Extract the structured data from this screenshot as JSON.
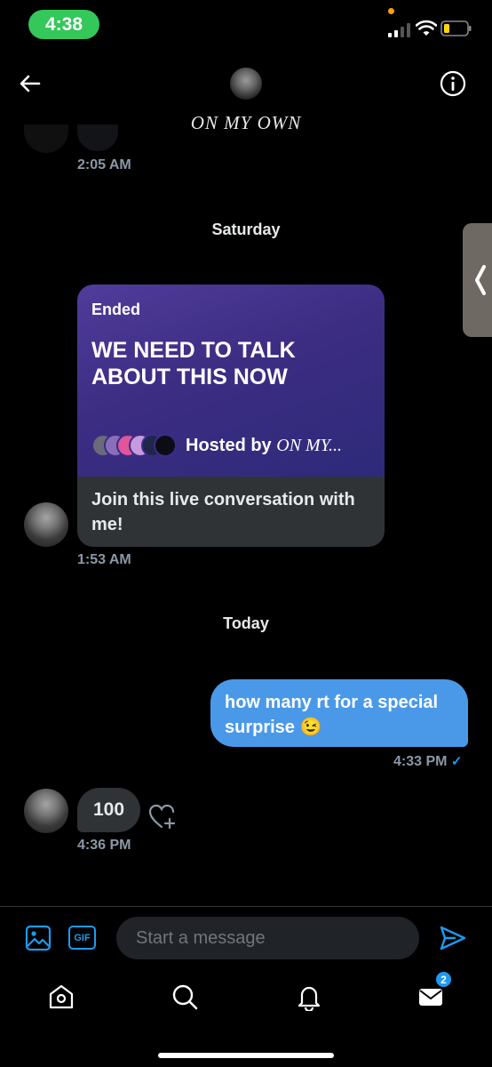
{
  "status_bar": {
    "time": "4:38"
  },
  "header": {
    "title": "ON MY OWN",
    "back_icon": "arrow-left-icon",
    "info_icon": "info-icon"
  },
  "conversation": {
    "earlier_timestamp": "2:05 AM",
    "day_saturday": "Saturday",
    "space_card": {
      "status": "Ended",
      "title": "WE NEED TO TALK ABOUT THIS NOW",
      "hosted_by_label": "Hosted by",
      "host_name": "ON MY...",
      "footer_text": "Join this live conversation with me!",
      "gradient_colors": [
        "#503c9b",
        "#2e2a7a"
      ]
    },
    "space_timestamp": "1:53 AM",
    "day_today": "Today",
    "outgoing_message": {
      "text": "how many rt for a special surprise 😉",
      "timestamp": "4:33 PM",
      "read_mark": "✓"
    },
    "incoming_message": {
      "text": "100",
      "timestamp": "4:36 PM"
    }
  },
  "composer": {
    "placeholder": "Start a message",
    "gif_label": "GIF"
  },
  "tab_bar": {
    "items": [
      {
        "name": "home",
        "icon": "home-icon"
      },
      {
        "name": "search",
        "icon": "search-icon"
      },
      {
        "name": "notifications",
        "icon": "bell-icon"
      },
      {
        "name": "messages",
        "icon": "mail-icon",
        "badge": "2"
      }
    ]
  },
  "colors": {
    "accent": "#1d9bf0",
    "outgoing_bubble": "#4a99e9",
    "incoming_bubble": "#2f3336",
    "status_time_pill": "#34c759"
  }
}
